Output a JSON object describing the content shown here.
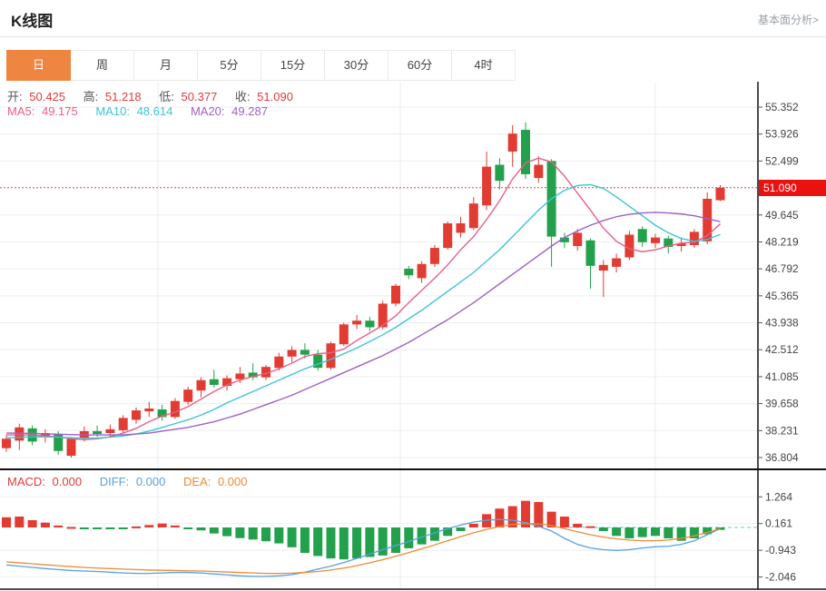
{
  "header": {
    "title": "K线图",
    "link_label": "基本面分析>"
  },
  "tabs": {
    "items": [
      {
        "key": "day",
        "label": "日",
        "active": true
      },
      {
        "key": "week",
        "label": "周",
        "active": false
      },
      {
        "key": "month",
        "label": "月",
        "active": false
      },
      {
        "key": "5min",
        "label": "5分",
        "active": false
      },
      {
        "key": "15min",
        "label": "15分",
        "active": false
      },
      {
        "key": "30min",
        "label": "30分",
        "active": false
      },
      {
        "key": "60min",
        "label": "60分",
        "active": false
      },
      {
        "key": "4hour",
        "label": "4时",
        "active": false
      }
    ]
  },
  "ohlc": {
    "open_label": "开:",
    "open": "50.425",
    "high_label": "高:",
    "high": "51.218",
    "low_label": "低:",
    "low": "50.377",
    "close_label": "收:",
    "close": "51.090"
  },
  "ma_legend": [
    {
      "label": "MA5:",
      "value": "49.175"
    },
    {
      "label": "MA10:",
      "value": "48.614"
    },
    {
      "label": "MA20:",
      "value": "49.287"
    }
  ],
  "macd_legend": [
    {
      "label": "MACD:",
      "value": "0.000"
    },
    {
      "label": "DIFF:",
      "value": "0.000"
    },
    {
      "label": "DEA:",
      "value": "0.000"
    }
  ],
  "price_badge": "51.090",
  "colors": {
    "up": "#e13b32",
    "down": "#22a04b",
    "ma5": "#e85f88",
    "ma10": "#3fc3d6",
    "ma20": "#9d62c4",
    "diff": "#55a1e3",
    "dea": "#ef8a33",
    "badge_bg": "#ea1111",
    "dotted_line": "#e04040",
    "tab_active_bg": "#ee8540",
    "ohlc_label": "#555555",
    "ohlc_value": "#e23b3b",
    "grid": "#ededed",
    "vgrid": "#e7edf3",
    "axis_line": "#111111",
    "axis_text": "#444444",
    "zero_dash": "#5bc8d5"
  },
  "chart_data": [
    {
      "type": "candlestick",
      "title": "K线图 (日K)",
      "legend_position": "top-left-overlay",
      "grid": true,
      "y_axis": {
        "min": 36.804,
        "max": 55.352,
        "position": "right"
      },
      "y_tick_labels": [
        "55.352",
        "53.926",
        "52.499",
        "49.645",
        "48.219",
        "46.792",
        "45.365",
        "43.938",
        "42.512",
        "41.085",
        "39.658",
        "38.231",
        "36.804"
      ],
      "current_price": 51.09,
      "candles_ohlc": [
        [
          37.3,
          38.0,
          37.1,
          37.8
        ],
        [
          37.7,
          38.6,
          37.2,
          38.4
        ],
        [
          38.35,
          38.5,
          37.45,
          37.65
        ],
        [
          37.9,
          38.3,
          37.6,
          38.1
        ],
        [
          38.05,
          38.2,
          36.95,
          37.15
        ],
        [
          36.9,
          37.9,
          36.8,
          37.8
        ],
        [
          37.85,
          38.45,
          37.65,
          38.2
        ],
        [
          38.2,
          38.5,
          37.9,
          38.05
        ],
        [
          38.1,
          38.55,
          37.85,
          38.3
        ],
        [
          38.25,
          39.05,
          38.1,
          38.9
        ],
        [
          38.8,
          39.45,
          38.6,
          39.3
        ],
        [
          39.25,
          39.75,
          38.95,
          39.4
        ],
        [
          39.35,
          39.6,
          38.75,
          38.95
        ],
        [
          38.95,
          39.95,
          38.85,
          39.8
        ],
        [
          39.75,
          40.55,
          39.6,
          40.4
        ],
        [
          40.35,
          41.05,
          40.0,
          40.9
        ],
        [
          40.95,
          41.45,
          40.5,
          40.65
        ],
        [
          40.6,
          41.15,
          40.35,
          41.0
        ],
        [
          40.95,
          41.6,
          40.75,
          41.25
        ],
        [
          41.3,
          41.8,
          40.9,
          41.05
        ],
        [
          41.05,
          41.7,
          40.9,
          41.6
        ],
        [
          41.55,
          42.35,
          41.4,
          42.15
        ],
        [
          42.15,
          42.7,
          41.85,
          42.5
        ],
        [
          42.5,
          42.85,
          42.05,
          42.25
        ],
        [
          42.25,
          42.5,
          41.4,
          41.55
        ],
        [
          41.55,
          42.95,
          41.45,
          42.85
        ],
        [
          42.8,
          43.95,
          42.7,
          43.85
        ],
        [
          43.85,
          44.35,
          43.6,
          44.05
        ],
        [
          44.05,
          44.25,
          43.5,
          43.7
        ],
        [
          43.7,
          45.1,
          43.6,
          44.95
        ],
        [
          44.95,
          46.0,
          44.8,
          45.9
        ],
        [
          46.8,
          46.95,
          46.25,
          46.45
        ],
        [
          46.3,
          47.2,
          46.05,
          47.05
        ],
        [
          47.05,
          48.05,
          46.9,
          47.9
        ],
        [
          47.9,
          49.3,
          47.8,
          49.2
        ],
        [
          48.7,
          49.55,
          48.45,
          49.2
        ],
        [
          48.95,
          50.6,
          48.85,
          50.25
        ],
        [
          50.15,
          53.0,
          49.9,
          52.2
        ],
        [
          52.3,
          52.65,
          51.0,
          51.45
        ],
        [
          53.0,
          54.4,
          52.2,
          53.95
        ],
        [
          54.15,
          54.55,
          51.55,
          51.8
        ],
        [
          51.6,
          52.75,
          51.35,
          52.3
        ],
        [
          52.5,
          52.6,
          46.9,
          48.5
        ],
        [
          48.45,
          48.7,
          47.9,
          48.2
        ],
        [
          48.0,
          48.9,
          47.75,
          48.7
        ],
        [
          48.3,
          48.4,
          45.75,
          46.95
        ],
        [
          46.7,
          47.25,
          45.3,
          47.0
        ],
        [
          46.9,
          47.6,
          46.6,
          47.35
        ],
        [
          47.4,
          48.8,
          47.25,
          48.6
        ],
        [
          48.9,
          49.05,
          47.95,
          48.2
        ],
        [
          48.15,
          48.65,
          47.9,
          48.45
        ],
        [
          48.4,
          48.55,
          47.6,
          47.95
        ],
        [
          48.0,
          48.45,
          47.7,
          48.15
        ],
        [
          48.05,
          48.9,
          47.9,
          48.75
        ],
        [
          48.25,
          50.85,
          48.1,
          50.5
        ],
        [
          50.425,
          51.218,
          50.377,
          51.09
        ]
      ],
      "series": [
        {
          "name": "MA5",
          "values": [
            38.0,
            38.0,
            38.0,
            37.95,
            37.9,
            37.8,
            37.75,
            37.8,
            37.9,
            38.1,
            38.35,
            38.7,
            39.0,
            39.2,
            39.5,
            39.9,
            40.3,
            40.65,
            40.9,
            41.1,
            41.25,
            41.5,
            41.8,
            42.15,
            42.3,
            42.35,
            42.55,
            43.0,
            43.4,
            43.8,
            44.3,
            45.0,
            45.65,
            46.3,
            47.0,
            47.8,
            48.5,
            49.4,
            50.4,
            51.55,
            52.4,
            52.65,
            52.45,
            51.7,
            50.8,
            49.9,
            48.95,
            48.25,
            47.85,
            47.7,
            47.8,
            48.0,
            48.15,
            48.2,
            48.55,
            49.175
          ]
        },
        {
          "name": "MA10",
          "values": [
            37.85,
            37.87,
            37.9,
            37.9,
            37.88,
            37.85,
            37.83,
            37.84,
            37.88,
            37.95,
            38.05,
            38.2,
            38.4,
            38.6,
            38.8,
            39.05,
            39.35,
            39.7,
            40.0,
            40.3,
            40.6,
            40.9,
            41.2,
            41.5,
            41.75,
            42.0,
            42.3,
            42.6,
            42.95,
            43.3,
            43.7,
            44.15,
            44.6,
            45.1,
            45.6,
            46.1,
            46.6,
            47.2,
            47.8,
            48.5,
            49.2,
            49.9,
            50.5,
            50.95,
            51.2,
            51.25,
            51.05,
            50.6,
            50.1,
            49.6,
            49.1,
            48.7,
            48.4,
            48.25,
            48.35,
            48.614
          ]
        },
        {
          "name": "MA20",
          "values": [
            38.1,
            38.1,
            38.08,
            38.06,
            38.04,
            38.02,
            38.0,
            38.0,
            38.0,
            38.0,
            38.05,
            38.1,
            38.2,
            38.3,
            38.4,
            38.55,
            38.7,
            38.9,
            39.1,
            39.35,
            39.6,
            39.85,
            40.1,
            40.4,
            40.7,
            41.0,
            41.3,
            41.6,
            41.9,
            42.2,
            42.55,
            42.9,
            43.3,
            43.7,
            44.1,
            44.55,
            45.0,
            45.5,
            46.0,
            46.5,
            47.0,
            47.5,
            48.0,
            48.45,
            48.8,
            49.1,
            49.35,
            49.55,
            49.68,
            49.75,
            49.78,
            49.75,
            49.7,
            49.6,
            49.45,
            49.287
          ]
        }
      ]
    },
    {
      "type": "bar",
      "title": "MACD",
      "y_tick_labels": [
        "1.264",
        "0.161",
        "-0.943",
        "-2.046"
      ],
      "histogram": [
        0.42,
        0.45,
        0.3,
        0.2,
        0.08,
        0.02,
        -0.03,
        -0.05,
        -0.05,
        -0.03,
        0.04,
        0.1,
        0.16,
        0.08,
        -0.06,
        -0.12,
        -0.25,
        -0.36,
        -0.44,
        -0.5,
        -0.57,
        -0.66,
        -0.82,
        -1.05,
        -1.18,
        -1.28,
        -1.32,
        -1.28,
        -1.22,
        -1.16,
        -1.05,
        -0.86,
        -0.7,
        -0.55,
        -0.35,
        -0.15,
        0.15,
        0.55,
        0.78,
        0.88,
        1.1,
        1.05,
        0.65,
        0.45,
        0.15,
        0.05,
        -0.15,
        -0.35,
        -0.45,
        -0.4,
        -0.35,
        -0.45,
        -0.55,
        -0.45,
        -0.28,
        -0.1
      ],
      "series": [
        {
          "name": "DIFF",
          "values": [
            -1.55,
            -1.6,
            -1.65,
            -1.7,
            -1.74,
            -1.78,
            -1.8,
            -1.82,
            -1.85,
            -1.88,
            -1.9,
            -1.9,
            -1.88,
            -1.86,
            -1.86,
            -1.88,
            -1.92,
            -1.96,
            -2.0,
            -2.02,
            -2.02,
            -2.0,
            -1.95,
            -1.85,
            -1.72,
            -1.6,
            -1.45,
            -1.28,
            -1.1,
            -0.92,
            -0.75,
            -0.58,
            -0.4,
            -0.22,
            -0.05,
            0.1,
            0.22,
            0.3,
            0.33,
            0.3,
            0.2,
            0.05,
            -0.15,
            -0.45,
            -0.7,
            -0.85,
            -0.92,
            -0.95,
            -0.92,
            -0.85,
            -0.8,
            -0.78,
            -0.7,
            -0.55,
            -0.3,
            -0.05
          ]
        },
        {
          "name": "DEA",
          "values": [
            -1.42,
            -1.46,
            -1.5,
            -1.54,
            -1.58,
            -1.62,
            -1.65,
            -1.68,
            -1.7,
            -1.72,
            -1.74,
            -1.76,
            -1.77,
            -1.78,
            -1.79,
            -1.8,
            -1.82,
            -1.84,
            -1.86,
            -1.88,
            -1.9,
            -1.9,
            -1.89,
            -1.86,
            -1.82,
            -1.76,
            -1.68,
            -1.58,
            -1.46,
            -1.33,
            -1.19,
            -1.04,
            -0.88,
            -0.72,
            -0.55,
            -0.38,
            -0.22,
            -0.08,
            0.04,
            0.12,
            0.16,
            0.15,
            0.08,
            -0.05,
            -0.18,
            -0.3,
            -0.4,
            -0.47,
            -0.52,
            -0.55,
            -0.55,
            -0.52,
            -0.45,
            -0.35,
            -0.2,
            -0.05
          ]
        }
      ]
    }
  ]
}
